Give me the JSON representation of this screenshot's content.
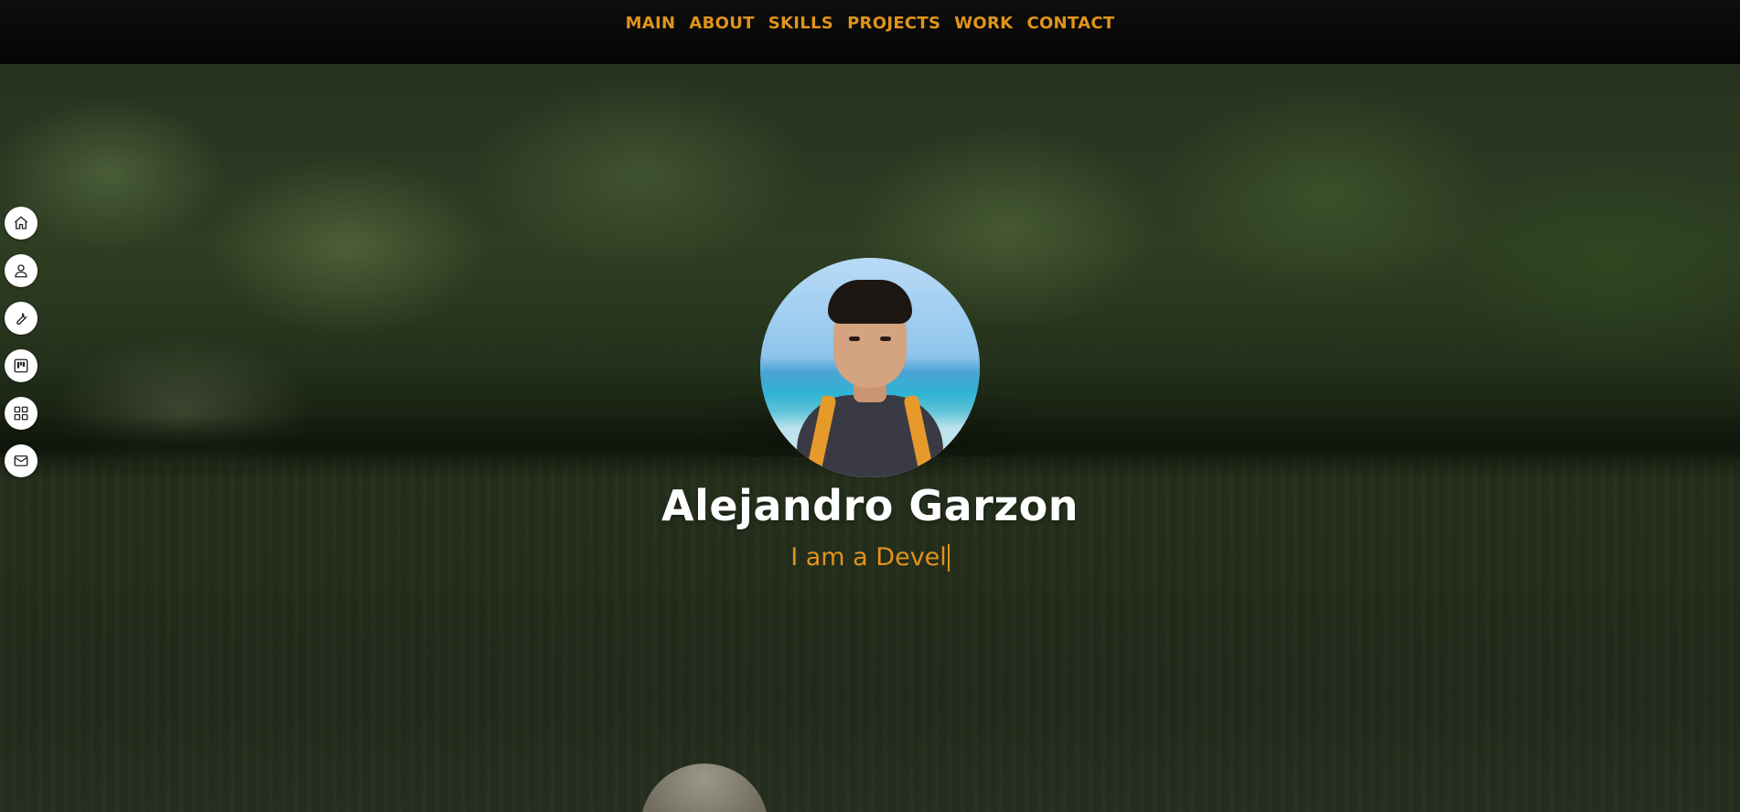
{
  "nav": {
    "items": [
      {
        "label": "MAIN"
      },
      {
        "label": "ABOUT"
      },
      {
        "label": "SKILLS"
      },
      {
        "label": "PROJECTS"
      },
      {
        "label": "WORK"
      },
      {
        "label": "CONTACT"
      }
    ]
  },
  "sidebar": {
    "icons": [
      {
        "icon": "home-icon"
      },
      {
        "icon": "user-icon"
      },
      {
        "icon": "wrench-icon"
      },
      {
        "icon": "kanban-icon"
      },
      {
        "icon": "grid-icon"
      },
      {
        "icon": "mail-icon"
      }
    ]
  },
  "hero": {
    "name": "Alejandro Garzon",
    "tagline": "I am a Devel"
  },
  "colors": {
    "accent": "#e0941a",
    "topbar": "#0a0a0a",
    "name": "#ffffff",
    "side_button": "#ffffff"
  }
}
